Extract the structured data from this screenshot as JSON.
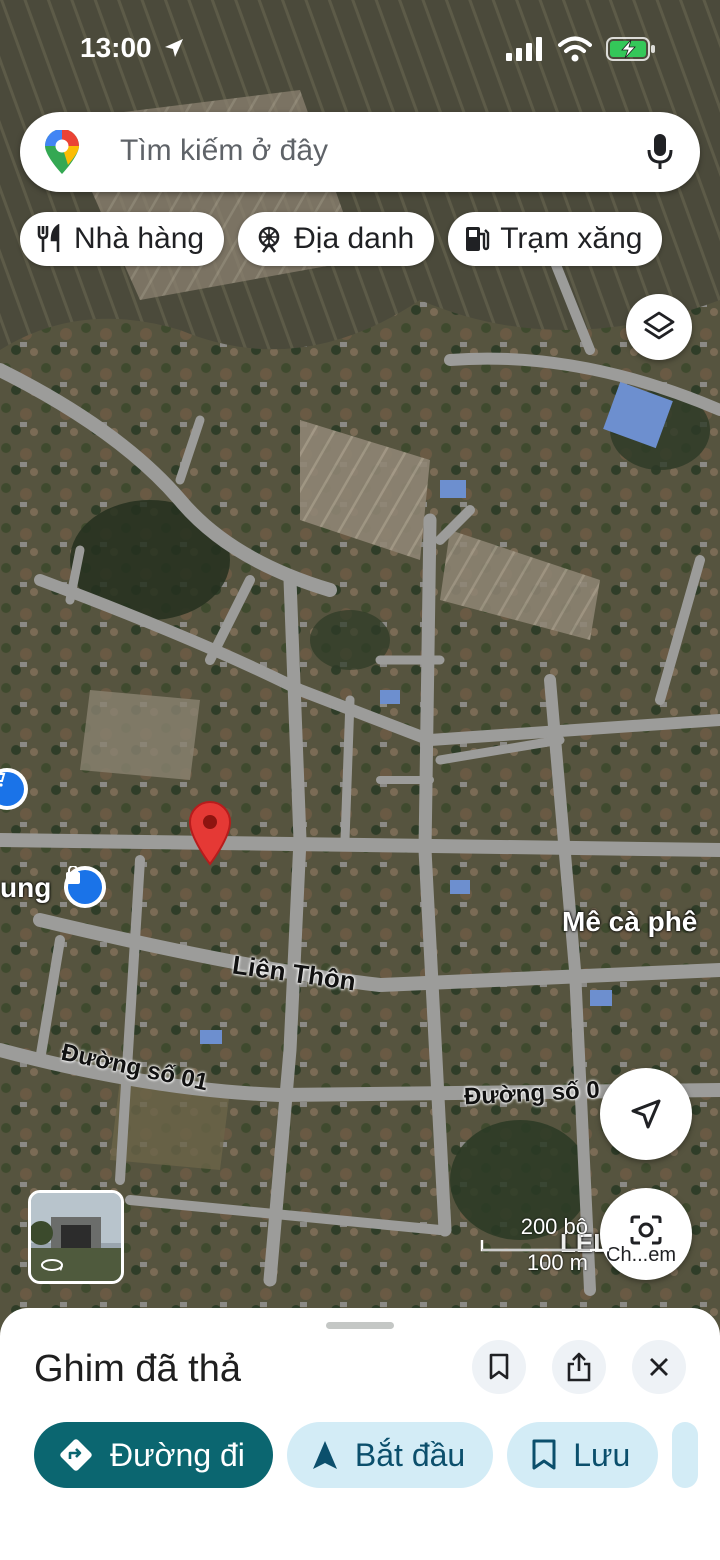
{
  "status": {
    "time": "13:00"
  },
  "search": {
    "placeholder": "Tìm kiếm ở đây"
  },
  "chips": [
    {
      "label": "Nhà hàng",
      "icon": "restaurant-icon"
    },
    {
      "label": "Địa danh",
      "icon": "landmark-icon"
    },
    {
      "label": "Trạm xăng",
      "icon": "gas-station-icon"
    }
  ],
  "map": {
    "labels": {
      "place_partial": "ung",
      "cafe": "Mê cà phê",
      "road_lien_thon": "Liên Thôn",
      "road_so01": "Đường số 01",
      "road_so0x": "Đường số 0"
    },
    "scale": {
      "feet": "200 bộ",
      "meters": "100 m"
    },
    "street_view_label": "Ch...em",
    "partial_text_right": "LEL SE"
  },
  "sheet": {
    "title": "Ghim đã thả",
    "actions": {
      "directions": "Đường đi",
      "start": "Bắt đầu",
      "save": "Lưu"
    }
  },
  "colors": {
    "accent": "#0b6670",
    "secondary": "#d3ecf6",
    "pin_red": "#e53935",
    "road": "#9a9a9a"
  }
}
